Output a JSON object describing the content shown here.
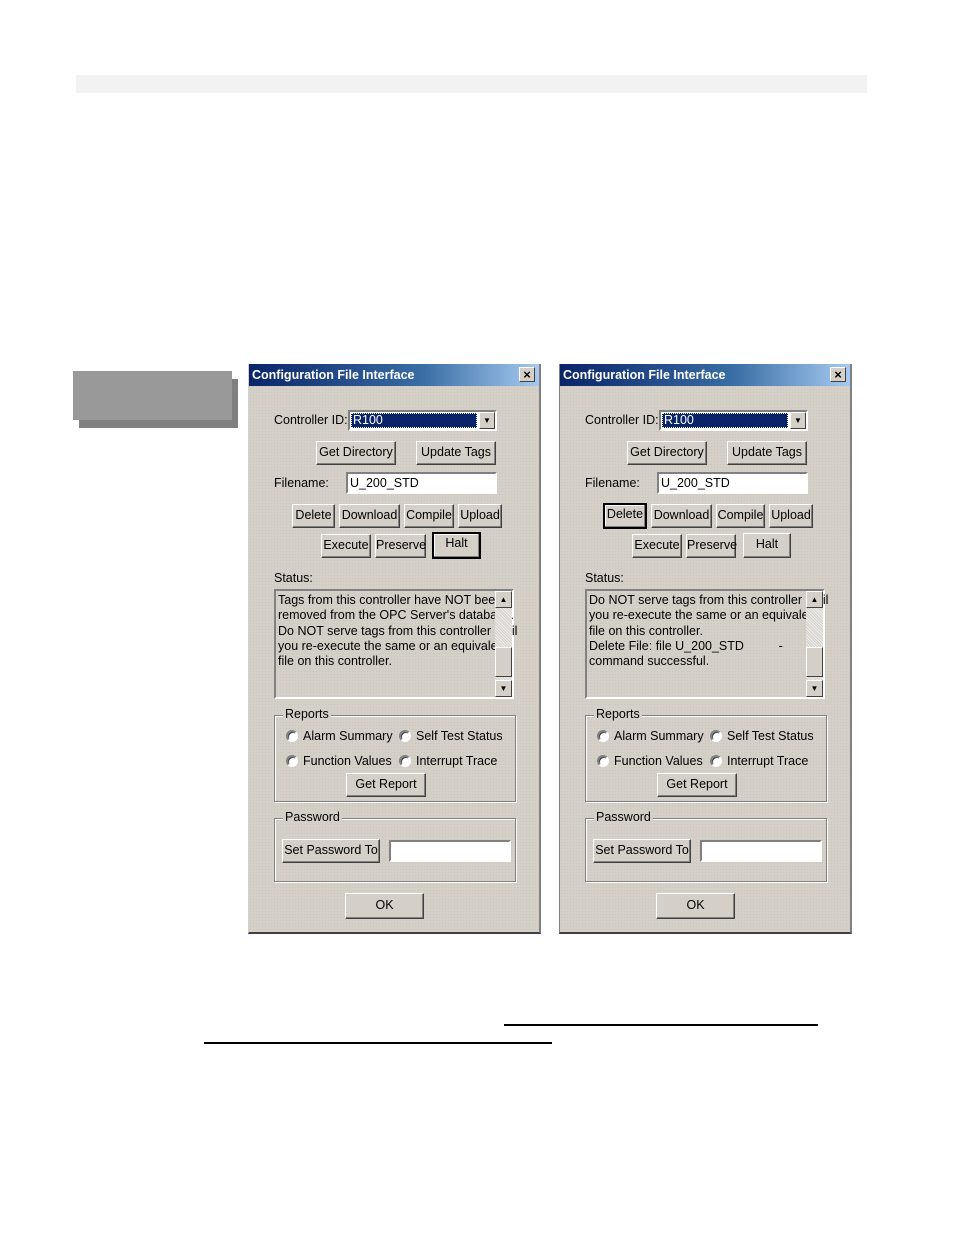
{
  "dialogs": [
    {
      "title": "Configuration File Interface",
      "close_icon": "×",
      "controller_id_label": "Controller ID:",
      "controller_id_value": "R100",
      "dropdown_icon": "▼",
      "get_directory": "Get Directory",
      "update_tags": "Update Tags",
      "filename_label": "Filename:",
      "filename_value": "U_200_STD",
      "delete": "Delete",
      "download": "Download",
      "compile": "Compile",
      "upload": "Upload",
      "execute": "Execute",
      "preserve": "Preserve",
      "halt": "Halt",
      "default_button": "halt",
      "status_label": "Status:",
      "status_lines": [
        "Tags from this controller have NOT been",
        "removed from the OPC Server's database.",
        "Do NOT serve tags from this controller until",
        "you re-execute the same or an equivalent",
        "file on this controller."
      ],
      "scroll_up_icon": "▲",
      "scroll_down_icon": "▼",
      "reports_legend": "Reports",
      "report_options": [
        "Alarm Summary",
        "Self Test Status",
        "Function Values",
        "Interrupt Trace"
      ],
      "get_report": "Get Report",
      "password_legend": "Password",
      "set_password": "Set Password To",
      "password_value": "",
      "ok": "OK"
    },
    {
      "title": "Configuration File Interface",
      "close_icon": "×",
      "controller_id_label": "Controller ID:",
      "controller_id_value": "R100",
      "dropdown_icon": "▼",
      "get_directory": "Get Directory",
      "update_tags": "Update Tags",
      "filename_label": "Filename:",
      "filename_value": "U_200_STD",
      "delete": "Delete",
      "download": "Download",
      "compile": "Compile",
      "upload": "Upload",
      "execute": "Execute",
      "preserve": "Preserve",
      "halt": "Halt",
      "default_button": "delete",
      "status_label": "Status:",
      "status_lines": [
        "Do NOT serve tags from this controller until",
        "you re-execute the same or an equivalent",
        "file on this controller.",
        "Delete File: file U_200_STD          -",
        "command successful."
      ],
      "scroll_up_icon": "▲",
      "scroll_down_icon": "▼",
      "reports_legend": "Reports",
      "report_options": [
        "Alarm Summary",
        "Self Test Status",
        "Function Values",
        "Interrupt Trace"
      ],
      "get_report": "Get Report",
      "password_legend": "Password",
      "set_password": "Set Password To",
      "password_value": "",
      "ok": "OK"
    }
  ]
}
